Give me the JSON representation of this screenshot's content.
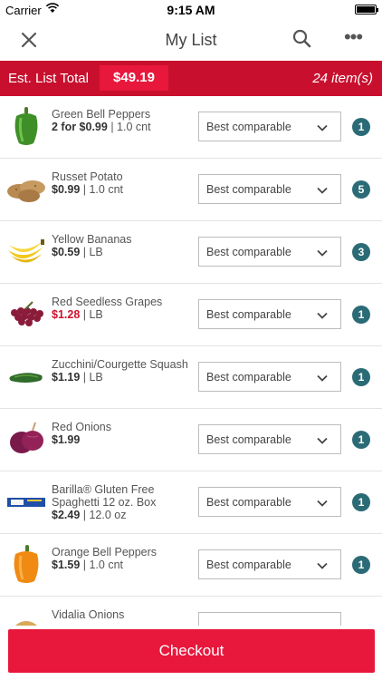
{
  "status_bar": {
    "carrier": "Carrier",
    "time": "9:15 AM"
  },
  "nav": {
    "title": "My List",
    "more": "•••"
  },
  "summary": {
    "label": "Est. List Total",
    "total": "$49.19",
    "count": "24 item(s)"
  },
  "items": [
    {
      "name": "Green Bell Peppers",
      "price": "2 for $0.99",
      "unit": "1.0 cnt",
      "sale": false,
      "substitution": "Best comparable",
      "qty": "1"
    },
    {
      "name": "Russet Potato",
      "price": "$0.99",
      "unit": "1.0 cnt",
      "sale": false,
      "substitution": "Best comparable",
      "qty": "5"
    },
    {
      "name": "Yellow Bananas",
      "price": "$0.59",
      "unit": "LB",
      "sale": false,
      "substitution": "Best comparable",
      "qty": "3"
    },
    {
      "name": "Red Seedless Grapes",
      "price": "$1.28",
      "unit": "LB",
      "sale": true,
      "substitution": "Best comparable",
      "qty": "1"
    },
    {
      "name": "Zucchini/Courgette Squash",
      "price": "$1.19",
      "unit": "LB",
      "sale": false,
      "substitution": "Best comparable",
      "qty": "1"
    },
    {
      "name": "Red Onions",
      "price": "$1.99",
      "unit": "",
      "sale": false,
      "substitution": "Best comparable",
      "qty": "1"
    },
    {
      "name": "Barilla® Gluten Free Spaghetti 12 oz. Box",
      "price": "$2.49",
      "unit": "12.0 oz",
      "sale": false,
      "substitution": "Best comparable",
      "qty": "1"
    },
    {
      "name": "Orange Bell Peppers",
      "price": "$1.59",
      "unit": "1.0 cnt",
      "sale": false,
      "substitution": "Best comparable",
      "qty": "1"
    },
    {
      "name": "Vidalia Onions",
      "price": "",
      "unit": "",
      "sale": false,
      "substitution": "",
      "qty": ""
    }
  ],
  "icons": [
    "close-icon",
    "search-icon",
    "more-icon",
    "chevron-down-icon",
    "wifi-icon",
    "battery-icon"
  ],
  "colors": {
    "brand_red": "#c8102e",
    "button_red": "#e8173c",
    "qty_badge": "#2a6b76",
    "sale_price": "#d0102e"
  },
  "checkout": {
    "label": "Checkout"
  }
}
